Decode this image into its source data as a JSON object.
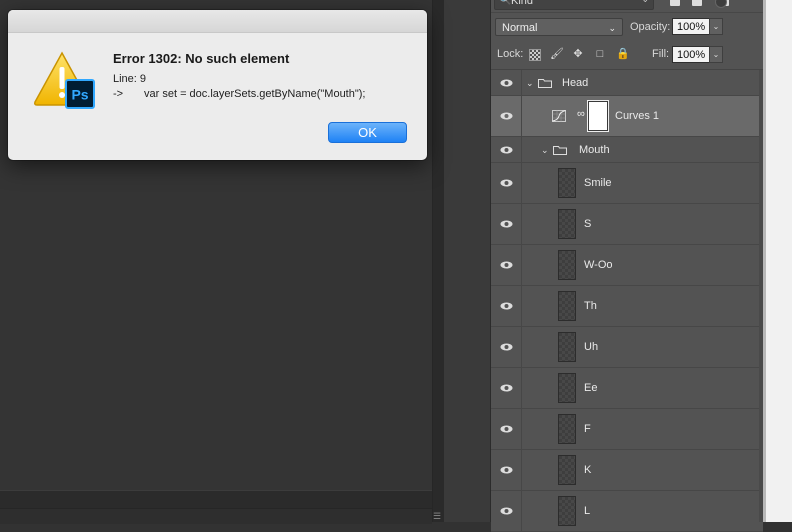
{
  "dialog": {
    "title": "Error 1302: No such element",
    "line_label": "Line: 9",
    "arrow": "->",
    "code": "var set = doc.layerSets.getByName(\"Mouth\");",
    "ok_label": "OK",
    "icon_badge": "Ps"
  },
  "layers_panel": {
    "filter_kind": "Kind",
    "blend_mode": "Normal",
    "opacity_label": "Opacity:",
    "opacity_value": "100%",
    "lock_label": "Lock:",
    "fill_label": "Fill:",
    "fill_value": "100%",
    "layers": [
      {
        "name": "Head",
        "type": "group"
      },
      {
        "name": "Curves 1",
        "type": "adjustment"
      },
      {
        "name": "Mouth",
        "type": "group"
      },
      {
        "name": "Smile",
        "type": "layer"
      },
      {
        "name": "S",
        "type": "layer"
      },
      {
        "name": "W-Oo",
        "type": "layer"
      },
      {
        "name": "Th",
        "type": "layer"
      },
      {
        "name": "Uh",
        "type": "layer"
      },
      {
        "name": "Ee",
        "type": "layer"
      },
      {
        "name": "F",
        "type": "layer"
      },
      {
        "name": "K",
        "type": "layer"
      },
      {
        "name": "L",
        "type": "layer"
      }
    ]
  },
  "colors": {
    "ok_button": "#1f82f5",
    "panel_bg": "#535353",
    "selected_row": "#6a6a6a",
    "dialog_bg": "#ececec"
  }
}
